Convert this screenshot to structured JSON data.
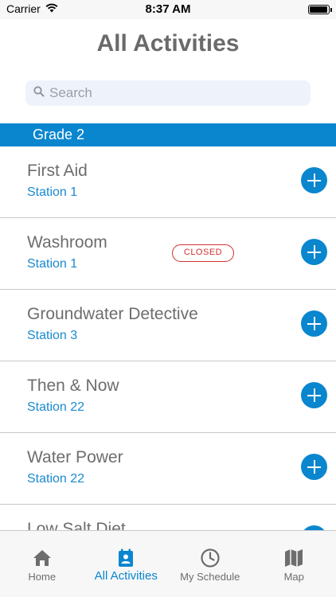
{
  "status_bar": {
    "carrier": "Carrier",
    "time": "8:37 AM"
  },
  "page_title": "All Activities",
  "search": {
    "placeholder": "Search"
  },
  "section": {
    "title": "Grade 2"
  },
  "activities": [
    {
      "title": "First Aid",
      "station": "Station 1",
      "badge": ""
    },
    {
      "title": "Washroom",
      "station": "Station 1",
      "badge": "CLOSED"
    },
    {
      "title": "Groundwater Detective",
      "station": "Station 3",
      "badge": ""
    },
    {
      "title": "Then & Now",
      "station": "Station 22",
      "badge": ""
    },
    {
      "title": "Water Power",
      "station": "Station 22",
      "badge": ""
    },
    {
      "title": "Low Salt Diet",
      "station": "",
      "badge": ""
    }
  ],
  "tabs": [
    {
      "label": "Home",
      "icon": "home-icon",
      "active": false
    },
    {
      "label": "All Activities",
      "icon": "calendar-person-icon",
      "active": true
    },
    {
      "label": "My Schedule",
      "icon": "clock-icon",
      "active": false
    },
    {
      "label": "Map",
      "icon": "map-icon",
      "active": false
    }
  ],
  "colors": {
    "accent": "#0a86cf",
    "closed": "#d0312d",
    "text": "#6d6d6d"
  }
}
